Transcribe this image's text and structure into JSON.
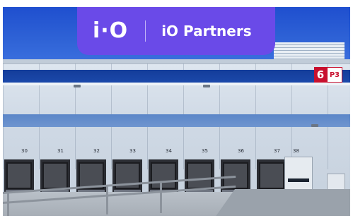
{
  "brand": {
    "mark": "i·O",
    "name": "iO Partners",
    "banner_color": "#6a4ae8"
  },
  "building": {
    "unit_sign": {
      "number": "6",
      "badge": "P3"
    },
    "dock_numbers": [
      "30",
      "31",
      "32",
      "33",
      "34",
      "35",
      "36",
      "37",
      "38"
    ]
  }
}
